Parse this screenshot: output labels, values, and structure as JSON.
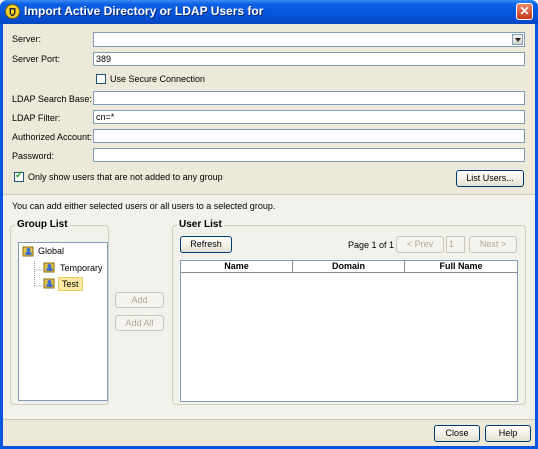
{
  "window": {
    "title": "Import Active Directory or LDAP Users for",
    "close_glyph": "✕",
    "title_icon": "shield-icon"
  },
  "form": {
    "server_label": "Server:",
    "server_value": "",
    "port_label": "Server Port:",
    "port_value": "389",
    "secure_label": "Use Secure Connection",
    "secure_checked": false,
    "search_base_label": "LDAP Search Base:",
    "search_base_value": "",
    "filter_label": "LDAP Filter:",
    "filter_value": "cn=*",
    "account_label": "Authorized Account:",
    "account_value": "",
    "password_label": "Password:",
    "password_value": "",
    "only_show_label": "Only show users that are not added to any group",
    "only_show_checked": true,
    "list_users_label": "List Users..."
  },
  "info_text": "You can add either selected users or all users to a selected group.",
  "group_list": {
    "title": "Group List",
    "nodes": [
      {
        "label": "Global",
        "icon": "users-group-icon"
      },
      {
        "label": "Temporary",
        "icon": "users-group-icon"
      },
      {
        "label": "Test",
        "icon": "users-group-icon",
        "selected": true
      }
    ]
  },
  "actions": {
    "add_label": "Add",
    "add_all_label": "Add All"
  },
  "user_list": {
    "title": "User List",
    "refresh_label": "Refresh",
    "page_text": "Page 1 of 1",
    "prev_label": "< Prev",
    "page_input": "1",
    "next_label": "Next >",
    "columns": [
      "Name",
      "Domain",
      "Full Name"
    ],
    "rows": []
  },
  "footer": {
    "close_label": "Close",
    "help_label": "Help"
  },
  "colors": {
    "titlebar": "#0653d8",
    "dialog_bg": "#ece9d8",
    "selection": "#fde9a4"
  }
}
